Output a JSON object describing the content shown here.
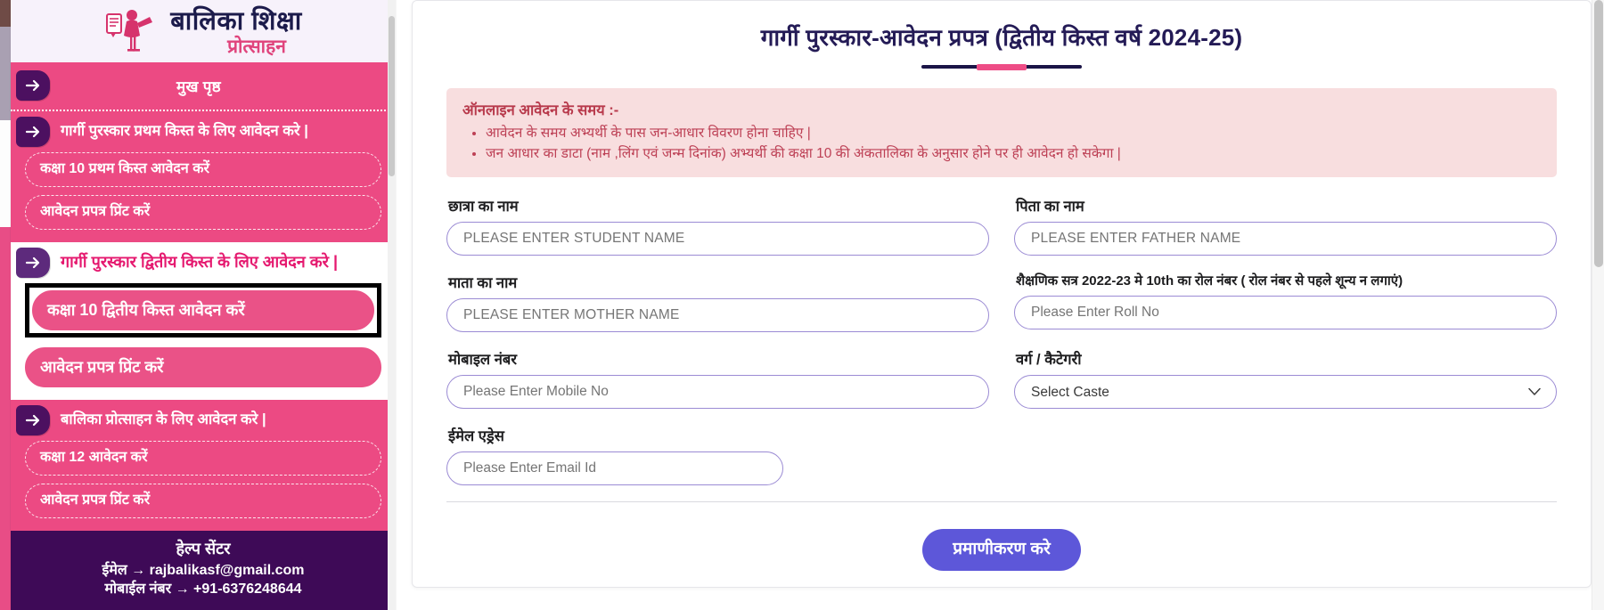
{
  "sidebar": {
    "brand": {
      "line1": "बालिका  शिक्षा",
      "line2": "प्रोत्साहन",
      "logo_icon": "girl-with-certificate-logo"
    },
    "home_label": "मुख पृष्ठ",
    "groups": [
      {
        "heading": "गार्गी पुरस्कार प्रथम किस्त के लिए आवेदन करे |",
        "style": "pink",
        "items": [
          {
            "label": "कक्षा 10 प्रथम किस्त आवेदन करें",
            "highlighted": false
          },
          {
            "label": "आवेदन प्रपत्र प्रिंट करें",
            "highlighted": false
          }
        ]
      },
      {
        "heading": "गार्गी पुरस्कार द्वितीय किस्त के लिए आवेदन करे |",
        "style": "white",
        "items": [
          {
            "label": "कक्षा 10 द्वितीय किस्त आवेदन करें",
            "highlighted": true
          },
          {
            "label": "आवेदन प्रपत्र प्रिंट करें",
            "highlighted": false
          }
        ]
      },
      {
        "heading": "बालिका प्रोत्साहन के लिए आवेदन करे |",
        "style": "pink",
        "items": [
          {
            "label": "कक्षा 12 आवेदन करें",
            "highlighted": false
          },
          {
            "label": "आवेदन प्रपत्र प्रिंट करें",
            "highlighted": false
          }
        ]
      }
    ],
    "help": {
      "title": "हेल्प सेंटर",
      "email_line": "ईमेल → rajbalikasf@gmail.com",
      "mobile_line": "मोबाईल नंबर → +91-6376248644"
    }
  },
  "main": {
    "title": "गार्गी पुरस्कार-आवेदन प्रपत्र (द्वितीय किस्त वर्ष 2024-25)",
    "notice": {
      "title": "ऑनलाइन आवेदन के समय :-",
      "bullets": [
        "आवेदन के समय अभ्यर्थी के पास जन-आधार विवरण होना चाहिए |",
        "जन आधार का डाटा (नाम ,लिंग एवं जन्म दिनांक) अभ्यर्थी की कक्षा 10 की अंकतालिका के अनुसार होने पर ही आवेदन हो सकेगा |"
      ]
    },
    "fields": {
      "student_name": {
        "label": "छात्रा का नाम",
        "placeholder": "PLEASE ENTER STUDENT NAME",
        "value": ""
      },
      "father_name": {
        "label": "पिता का नाम",
        "placeholder": "PLEASE ENTER FATHER NAME",
        "value": ""
      },
      "mother_name": {
        "label": "माता का नाम",
        "placeholder": "PLEASE ENTER MOTHER NAME",
        "value": ""
      },
      "roll_no": {
        "label": "शैक्षणिक सत्र 2022-23 मे 10th का रोल नंबर ( रोल नंबर से पहले शून्य न लगाएं)",
        "placeholder": "Please Enter Roll No",
        "value": ""
      },
      "mobile": {
        "label": "मोबाइल नंबर",
        "placeholder": "Please Enter Mobile No",
        "value": ""
      },
      "caste": {
        "label": "वर्ग / कैटेगरी",
        "selected": "Select Caste"
      },
      "email": {
        "label": "ईमेल एड्रेस",
        "placeholder": "Please Enter Email Id",
        "value": ""
      }
    },
    "submit_label": "प्रमाणीकरण करे"
  },
  "colors": {
    "pink": "#ec4a83",
    "deep_purple": "#4c1060",
    "title_navy": "#241b56",
    "notice_bg": "#f8dedf",
    "input_border": "#9b8bd4",
    "submit_bg": "#5d57d9",
    "help_bg": "#3e0a57"
  }
}
